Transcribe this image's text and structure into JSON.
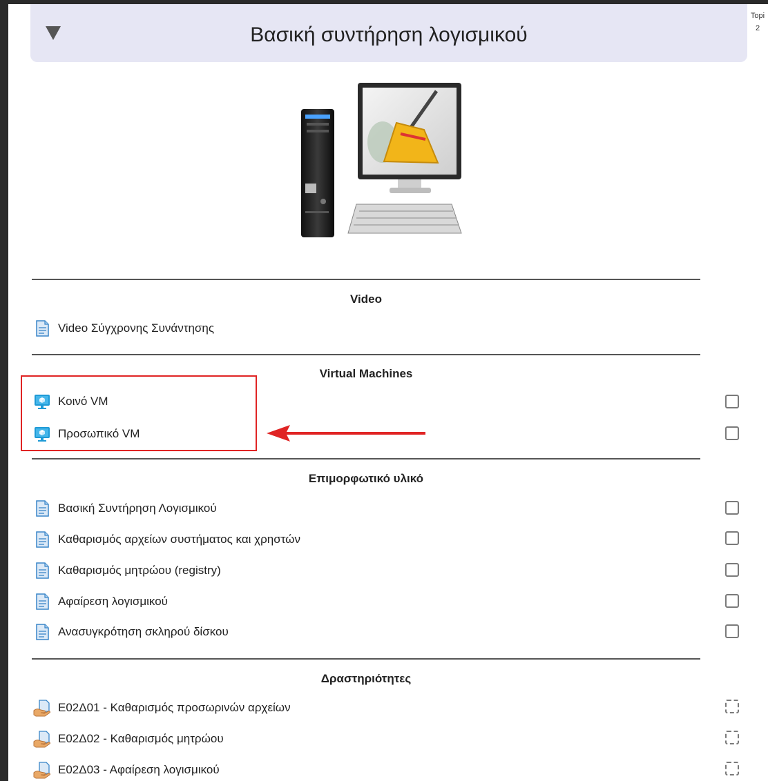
{
  "section": {
    "title": "Βασική συντήρηση λογισμικού",
    "topic_tag": [
      "Topi",
      "2"
    ]
  },
  "groups": [
    {
      "heading": "Video",
      "items": [
        {
          "label": "Video Σύγχρονης Συνάντησης",
          "icon": "document-icon",
          "check": "none"
        }
      ]
    },
    {
      "heading": "Virtual Machines",
      "items": [
        {
          "label": "Κοινό VM",
          "icon": "vm-monitor-icon",
          "check": "manual"
        },
        {
          "label": "Προσωπικό VM",
          "icon": "vm-monitor-icon",
          "check": "manual"
        }
      ]
    },
    {
      "heading": "Επιμορφωτικό υλικό",
      "items": [
        {
          "label": "Βασική Συντήρηση Λογισμικού",
          "icon": "document-icon",
          "check": "manual"
        },
        {
          "label": "Καθαρισμός αρχείων συστήματος και χρηστών",
          "icon": "document-icon",
          "check": "manual"
        },
        {
          "label": "Καθαρισμός μητρώου (registry)",
          "icon": "document-icon",
          "check": "manual"
        },
        {
          "label": "Αφαίρεση λογισμικού",
          "icon": "document-icon",
          "check": "manual"
        },
        {
          "label": "Ανασυγκρότηση σκληρού δίσκου",
          "icon": "document-icon",
          "check": "manual"
        }
      ]
    },
    {
      "heading": "Δραστηριότητες",
      "items": [
        {
          "label": "Ε02Δ01 - Καθαρισμός προσωρινών αρχείων",
          "icon": "assignment-icon",
          "check": "auto"
        },
        {
          "label": "Ε02Δ02 - Καθαρισμός μητρώου",
          "icon": "assignment-icon",
          "check": "auto"
        },
        {
          "label": "Ε02Δ03 - Αφαίρεση λογισμικού",
          "icon": "assignment-icon",
          "check": "auto"
        }
      ]
    }
  ],
  "colors": {
    "header_bg": "#e6e6f4",
    "highlight": "#e02424",
    "vm_icon": "#1e9ad6"
  }
}
